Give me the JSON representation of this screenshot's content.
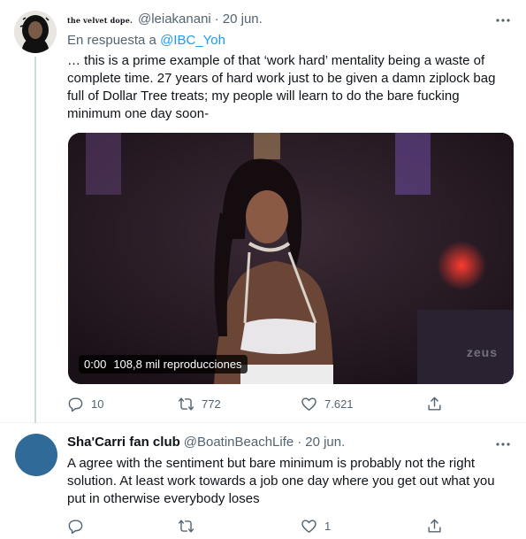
{
  "tweets": [
    {
      "display_name": "the velvet dope.",
      "handle": "@leiakanani",
      "separator": "·",
      "date": "20 jun.",
      "more_icon": "more-horizontal-icon",
      "reply_prefix": "En respuesta a",
      "reply_mention": "@IBC_Yoh",
      "text": "… this is a prime example of that ‘work hard’ mentality being a waste of complete time. 27 years of hard work just to be given a damn ziplock bag full of Dollar Tree treats; my people will learn to do the bare fucking minimum one day soon-",
      "video": {
        "time": "0:00",
        "views": "108,8 mil reproducciones",
        "watermark": "zeus"
      },
      "actions": {
        "replies": "10",
        "retweets": "772",
        "likes": "7.621"
      }
    },
    {
      "display_name": "Sha'Carri fan club",
      "handle": "@BoatinBeachLife",
      "separator": "·",
      "date": "20 jun.",
      "more_icon": "more-horizontal-icon",
      "text": "A agree with the sentiment but bare minimum is probably not the right solution. At least work towards a job one day where you get out what you put in otherwise everybody loses",
      "actions": {
        "replies": "",
        "retweets": "",
        "likes": "1"
      }
    }
  ],
  "colors": {
    "link": "#1d9bf0",
    "secondary_text": "#536471",
    "thread_line": "#cfd9de"
  }
}
